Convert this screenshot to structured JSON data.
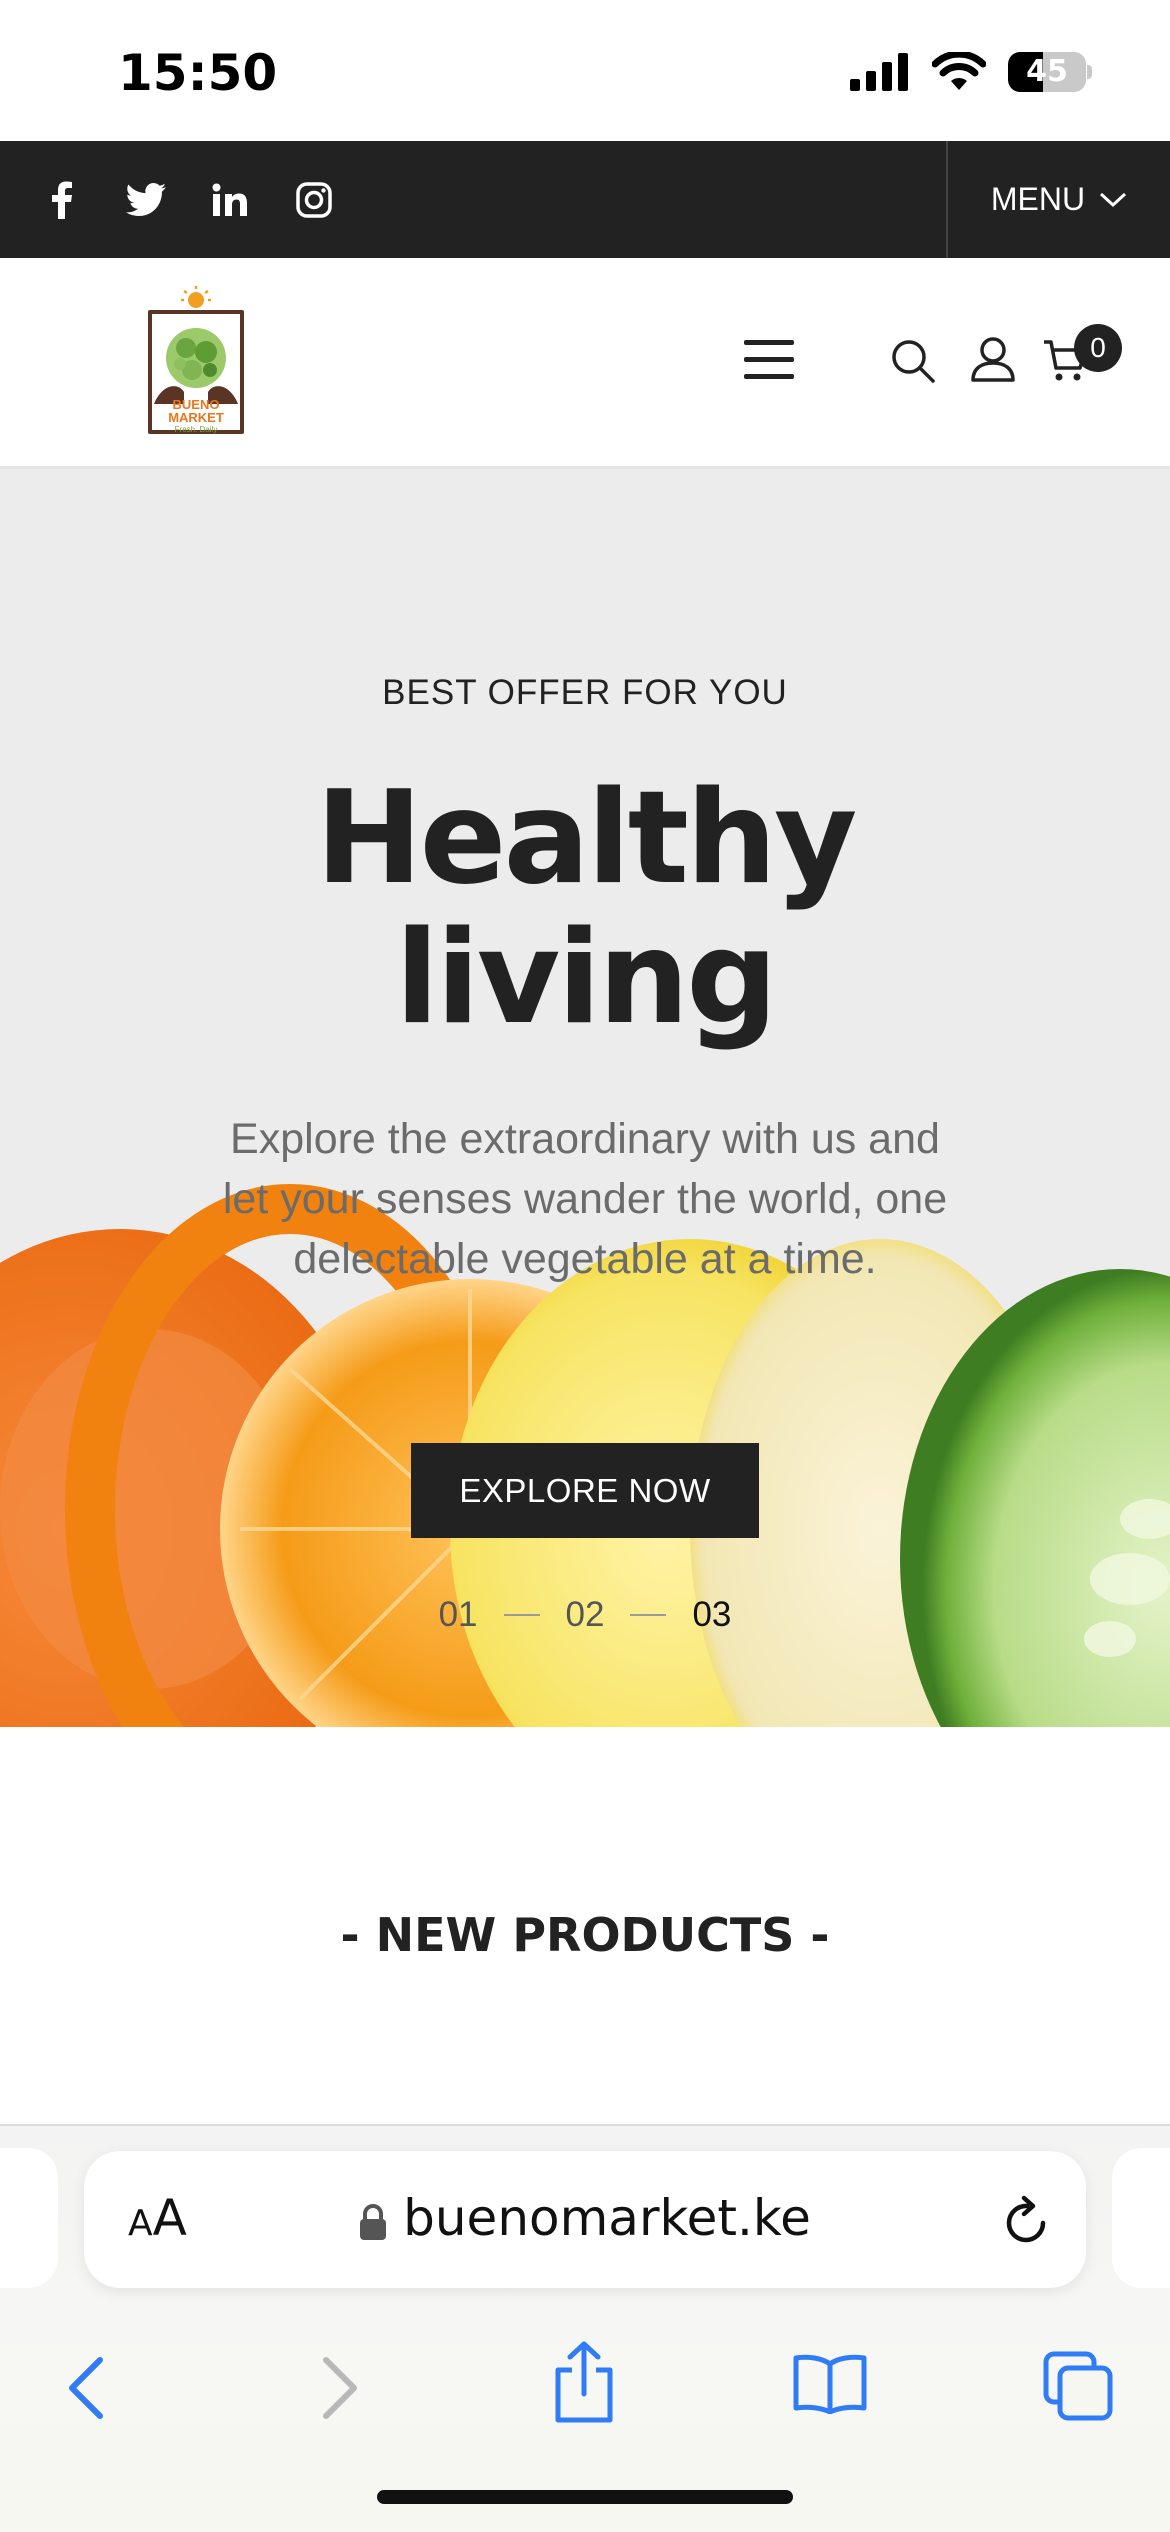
{
  "status_bar": {
    "time": "15:50",
    "battery": "45",
    "battery_level": 0.45
  },
  "topbar": {
    "social": [
      "facebook-icon",
      "twitter-icon",
      "linkedin-icon",
      "instagram-icon"
    ],
    "menu_label": "MENU"
  },
  "header": {
    "logo_text": "BUENO MARKET",
    "logo_tagline": "Fresh. Daily",
    "cart_count": "0"
  },
  "hero": {
    "kicker": "BEST OFFER FOR YOU",
    "title_line1": "Healthy",
    "title_line2": "living",
    "description": "Explore the extraordinary with us and let your senses wander the world, one delectable vegetable at a time.",
    "button_label": "EXPLORE NOW",
    "slides": [
      "01",
      "02",
      "03"
    ],
    "active_slide": "03"
  },
  "new_products": {
    "title": "- NEW PRODUCTS -"
  },
  "safari": {
    "text_size_small": "A",
    "text_size_big": "A",
    "url": "buenomarket.ke"
  },
  "colors": {
    "dark": "#222222",
    "hero_bg": "#ececec",
    "ios_blue": "#2f7cf6",
    "logo_orange": "#e8781e",
    "logo_green": "#7aa43a"
  }
}
